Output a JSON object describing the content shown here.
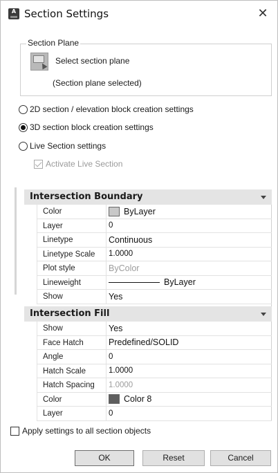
{
  "window": {
    "title": "Section Settings",
    "close_glyph": "✕"
  },
  "section_plane": {
    "legend": "Section Plane",
    "select_label": "Select section plane",
    "status": "(Section plane selected)"
  },
  "radios": [
    {
      "label": "2D section / elevation block creation settings",
      "checked": false
    },
    {
      "label": "3D section block creation settings",
      "checked": true
    },
    {
      "label": "Live Section settings",
      "checked": false
    }
  ],
  "live_section_checkbox": {
    "label": "Activate Live Section",
    "checked": true,
    "disabled": true
  },
  "intersection_boundary": {
    "title": "Intersection Boundary",
    "rows": [
      {
        "name": "Color",
        "value": "ByLayer",
        "swatch": "#c8c8c8"
      },
      {
        "name": "Layer",
        "value": "0"
      },
      {
        "name": "Linetype",
        "value": "Continuous"
      },
      {
        "name": "Linetype Scale",
        "value": "1.0000"
      },
      {
        "name": "Plot style",
        "value": "ByColor",
        "disabled": true
      },
      {
        "name": "Lineweight",
        "value": "ByLayer"
      },
      {
        "name": "Show",
        "value": "Yes"
      }
    ]
  },
  "intersection_fill": {
    "title": "Intersection Fill",
    "rows": [
      {
        "name": "Show",
        "value": "Yes"
      },
      {
        "name": "Face Hatch",
        "value": "Predefined/SOLID"
      },
      {
        "name": "Angle",
        "value": "0"
      },
      {
        "name": "Hatch Scale",
        "value": "1.0000"
      },
      {
        "name": "Hatch Spacing",
        "value": "1.0000",
        "disabled": true
      },
      {
        "name": "Color",
        "value": "Color 8",
        "swatch": "#5e5e5e"
      },
      {
        "name": "Layer",
        "value": "0"
      }
    ]
  },
  "apply_all": {
    "label": "Apply settings to all section objects",
    "checked": false
  },
  "buttons": {
    "ok": "OK",
    "reset": "Reset",
    "cancel": "Cancel"
  },
  "colors": {
    "header_bg": "#e4e4e4",
    "button_bg": "#e1e1e1"
  }
}
